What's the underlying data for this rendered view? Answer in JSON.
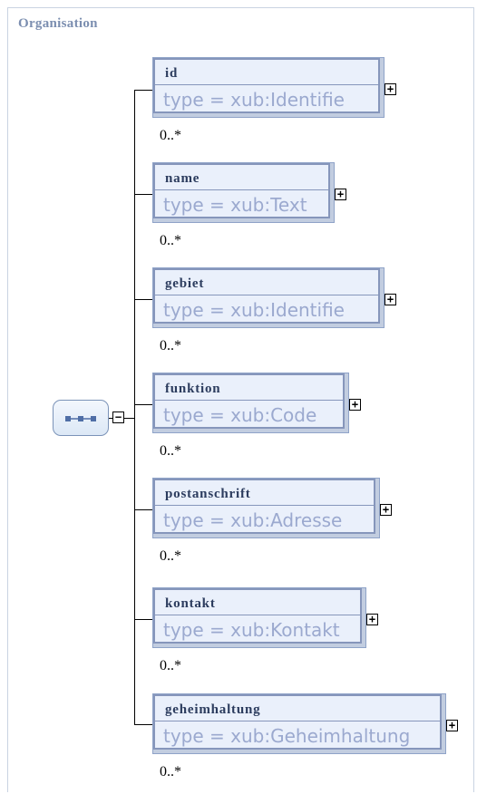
{
  "frame": {
    "title": "Organisation"
  },
  "sequence": {
    "icon": "sequence-compositor-icon",
    "toggle": "collapse"
  },
  "elements": [
    {
      "name": "id",
      "type": "type = xub:Identifie",
      "cardinality": "0..*"
    },
    {
      "name": "name",
      "type": "type = xub:Text",
      "cardinality": "0..*"
    },
    {
      "name": "gebiet",
      "type": "type = xub:Identifie",
      "cardinality": "0..*"
    },
    {
      "name": "funktion",
      "type": "type = xub:Code",
      "cardinality": "0..*"
    },
    {
      "name": "postanschrift",
      "type": "type = xub:Adresse",
      "cardinality": "0..*"
    },
    {
      "name": "kontakt",
      "type": "type = xub:Kontakt",
      "cardinality": "0..*"
    },
    {
      "name": "geheimhaltung",
      "type": "type = xub:Geheimhaltung",
      "cardinality": "0..*"
    }
  ]
}
